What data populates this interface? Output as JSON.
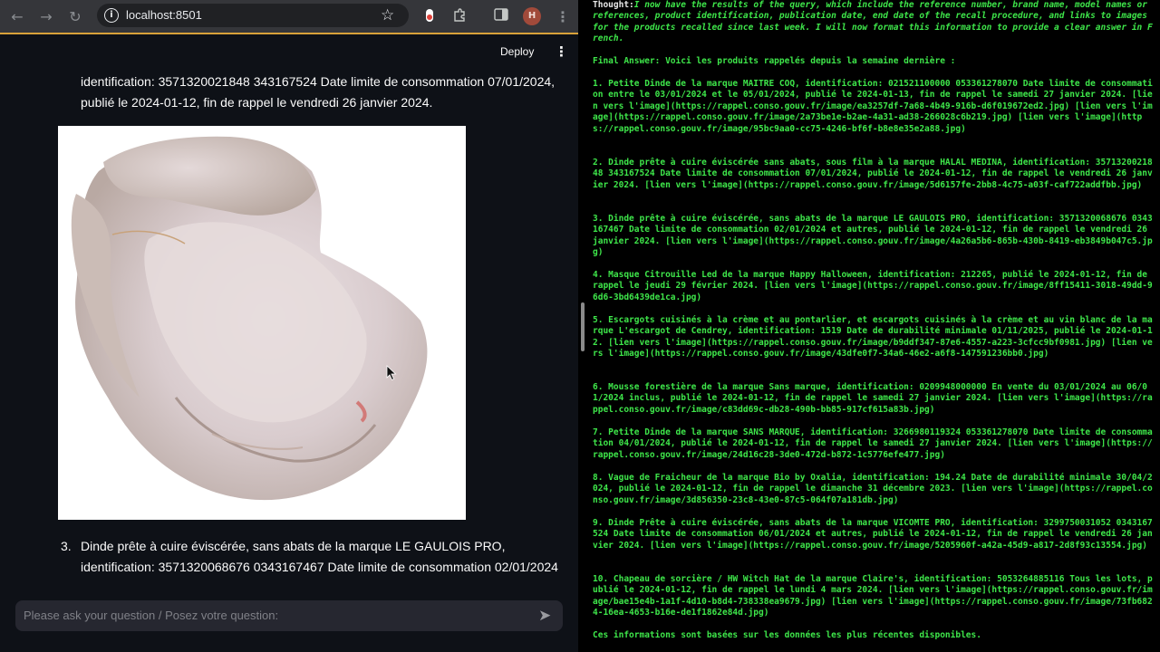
{
  "browser": {
    "url": "localhost:8501",
    "avatar_letter": "H",
    "accent_color": "#d9a23a"
  },
  "app_header": {
    "deploy_label": "Deploy"
  },
  "chat": {
    "top_paragraph": "identification: 3571320021848 343167524 Date limite de consommation 07/01/2024, publié le 2024-01-12, fin de rappel le vendredi 26 janvier 2024.",
    "item3_number": "3.",
    "item3_text": "Dinde prête à cuire éviscérée, sans abats de la marque LE GAULOIS PRO, identification: 3571320068676 0343167467 Date limite de consommation 02/01/2024 et autres, publié le 2024-01-12, fin de rappel le vendredi 26 janvier 2024.",
    "input_placeholder": "Please ask your question / Posez votre question:"
  },
  "terminal": {
    "thought_label": "Thought:",
    "thought_text": "I now have the results of the query, which include the reference number, brand name, model names or references, product identification, publication date, end date of the recall procedure, and links to images for the products recalled since last week. I will now format this information to provide a clear answer in French.",
    "final_answer": "Final Answer: Voici les produits rappelés depuis la semaine dernière :",
    "items": [
      "1. Petite Dinde de la marque MAITRE COQ, identification: 021521100000 053361278070 Date limite de consommation entre le 03/01/2024 et le 05/01/2024, publié le 2024-01-13, fin de rappel le samedi 27 janvier 2024. [lien vers l'image](https://rappel.conso.gouv.fr/image/ea3257df-7a68-4b49-916b-d6f019672ed2.jpg) [lien vers l'image](https://rappel.conso.gouv.fr/image/2a73be1e-b2ae-4a31-ad38-266028c6b219.jpg) [lien vers l'image](https://rappel.conso.gouv.fr/image/95bc9aa0-cc75-4246-bf6f-b8e8e35e2a88.jpg)",
      "2. Dinde prête à cuire éviscérée sans abats, sous film à la marque HALAL MEDINA, identification: 3571320021848 343167524 Date limite de consommation 07/01/2024, publié le 2024-01-12, fin de rappel le vendredi 26 janvier 2024. [lien vers l'image](https://rappel.conso.gouv.fr/image/5d6157fe-2bb8-4c75-a03f-caf722addfbb.jpg)",
      "3. Dinde prête à cuire éviscérée, sans abats de la marque LE GAULOIS PRO, identification: 3571320068676 0343167467 Date limite de consommation 02/01/2024 et autres, publié le 2024-01-12, fin de rappel le vendredi 26 janvier 2024. [lien vers l'image](https://rappel.conso.gouv.fr/image/4a26a5b6-865b-430b-8419-eb3849b047c5.jpg)",
      "4. Masque Citrouille Led de la marque Happy Halloween, identification: 212265, publié le 2024-01-12, fin de rappel le jeudi 29 février 2024. [lien vers l'image](https://rappel.conso.gouv.fr/image/8ff15411-3018-49dd-96d6-3bd6439de1ca.jpg)",
      "5. Escargots cuisinés à la crème et au pontarlier, et escargots cuisinés à la crème et au vin blanc de la marque L'escargot de Cendrey, identification: 1519 Date de durabilité minimale 01/11/2025, publié le 2024-01-12. [lien vers l'image](https://rappel.conso.gouv.fr/image/b9ddf347-87e6-4557-a223-3cfcc9bf0981.jpg) [lien vers l'image](https://rappel.conso.gouv.fr/image/43dfe0f7-34a6-46e2-a6f8-147591236bb0.jpg)",
      "6. Mousse forestière de la marque Sans marque, identification: 0209948000000 En vente du 03/01/2024 au 06/01/2024 inclus, publié le 2024-01-12, fin de rappel le samedi 27 janvier 2024. [lien vers l'image](https://rappel.conso.gouv.fr/image/c83dd69c-db28-490b-bb85-917cf615a83b.jpg)",
      "7. Petite Dinde de la marque SANS MARQUE, identification: 3266980119324 053361278070 Date limite de consommation 04/01/2024, publié le 2024-01-12, fin de rappel le samedi 27 janvier 2024. [lien vers l'image](https://rappel.conso.gouv.fr/image/24d16c28-3de0-472d-b872-1c5776efe477.jpg)",
      "8. Vague de Fraicheur de la marque Bio by Oxalia, identification: 194.24 Date de durabilité minimale 30/04/2024, publié le 2024-01-12, fin de rappel le dimanche 31 décembre 2023. [lien vers l'image](https://rappel.conso.gouv.fr/image/3d856350-23c8-43e0-87c5-064f07a181db.jpg)",
      "9. Dinde Prête à cuire éviscérée, sans abats de la marque VICOMTE PRO, identification: 3299750031052 0343167524 Date limite de consommation 06/01/2024 et autres, publié le 2024-01-12, fin de rappel le vendredi 26 janvier 2024. [lien vers l'image](https://rappel.conso.gouv.fr/image/5205960f-a42a-45d9-a817-2d8f93c13554.jpg)",
      "10. Chapeau de sorcière / HW Witch Hat de la marque Claire's, identification: 5053264885116 Tous les lots, publié le 2024-01-12, fin de rappel le lundi 4 mars 2024. [lien vers l'image](https://rappel.conso.gouv.fr/image/bae15e4b-1a1f-4d10-b8d4-738338ea9679.jpg) [lien vers l'image](https://rappel.conso.gouv.fr/image/73fb6824-16ea-4653-b16e-de1f1862e84d.jpg)"
    ],
    "footer": "Ces informations sont basées sur les données les plus récentes disponibles."
  }
}
